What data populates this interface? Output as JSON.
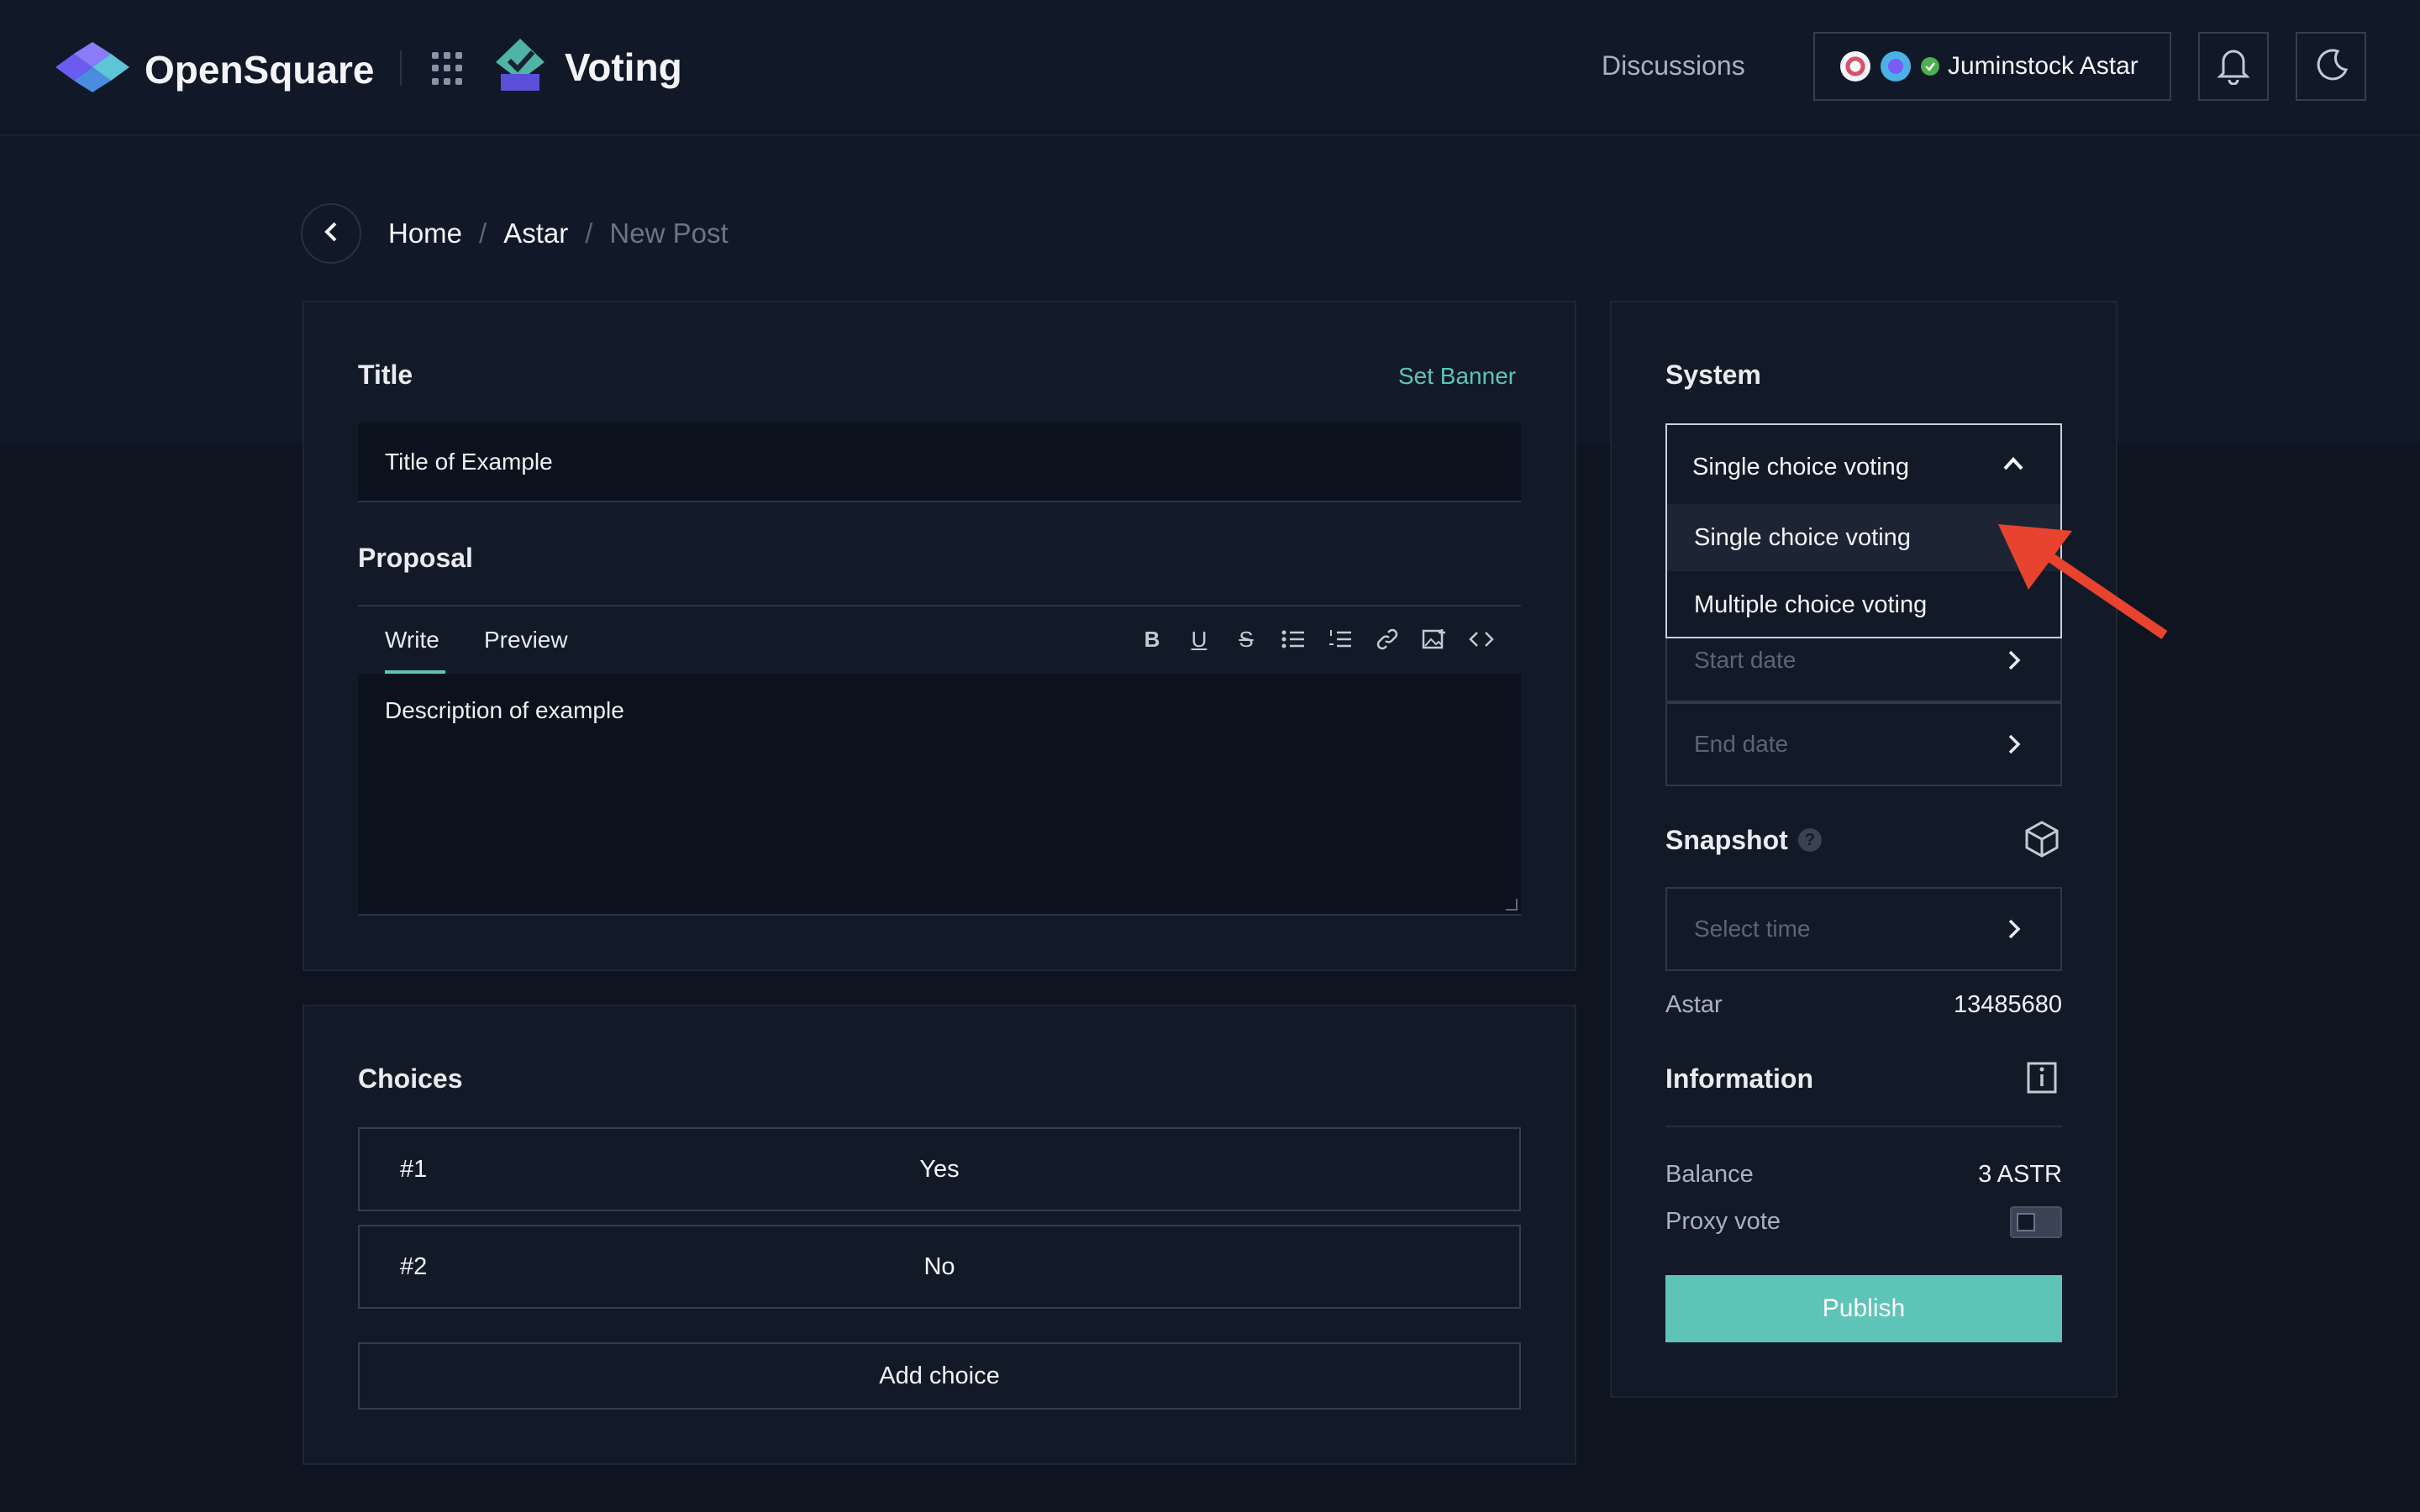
{
  "colors": {
    "accent": "#5ec4b7",
    "background": "#0e1420",
    "panel": "#121a28",
    "annotation_arrow": "#e8432e"
  },
  "header": {
    "brand": "OpenSquare",
    "app_name": "Voting",
    "nav_discussions": "Discussions",
    "account_name": "Juminstock Astar",
    "icons": [
      "opensquare-logo-icon",
      "apps-grid-icon",
      "voting-logo-icon",
      "polkadot-icon",
      "network-icon",
      "verified-check-icon",
      "bell-icon",
      "moon-icon"
    ]
  },
  "breadcrumb": {
    "home": "Home",
    "space": "Astar",
    "current": "New Post",
    "separator": "/"
  },
  "editor": {
    "title_label": "Title",
    "set_banner": "Set Banner",
    "title_value": "Title of Example",
    "proposal_label": "Proposal",
    "tab_write": "Write",
    "tab_preview": "Preview",
    "toolbar": [
      "bold-icon",
      "underline-icon",
      "strikethrough-icon",
      "bullet-list-icon",
      "numbered-list-icon",
      "link-icon",
      "image-icon",
      "code-icon"
    ],
    "description_value": "Description of example"
  },
  "choices": {
    "label": "Choices",
    "items": [
      {
        "num": "#1",
        "value": "Yes"
      },
      {
        "num": "#2",
        "value": "No"
      }
    ],
    "add_label": "Add choice"
  },
  "sidebar": {
    "system_label": "System",
    "system_selected": "Single choice voting",
    "system_options": [
      "Single choice voting",
      "Multiple choice voting"
    ],
    "start_date_placeholder": "Start date",
    "end_date_placeholder": "End date",
    "snapshot_label": "Snapshot",
    "snapshot_placeholder": "Select time",
    "snapshot_network": "Astar",
    "snapshot_block": "13485680",
    "information_label": "Information",
    "balance_label": "Balance",
    "balance_value": "3 ASTR",
    "proxy_vote_label": "Proxy vote",
    "proxy_vote_on": false,
    "publish_label": "Publish"
  }
}
